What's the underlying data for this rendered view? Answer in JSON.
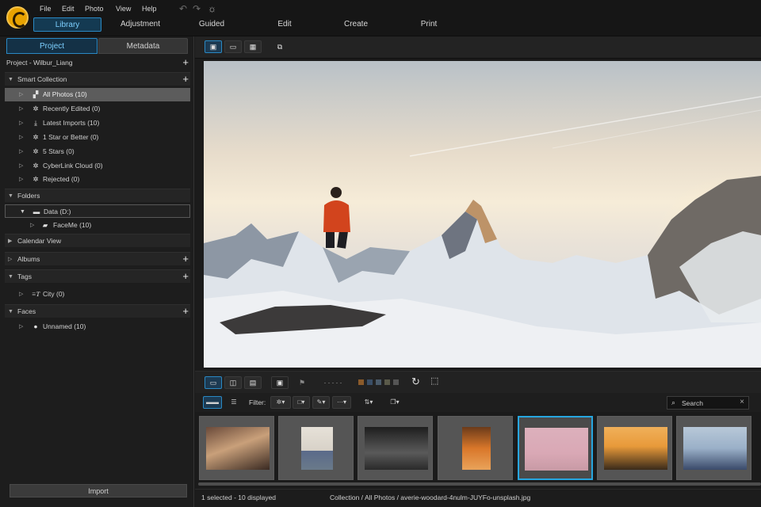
{
  "menu": [
    "File",
    "Edit",
    "Photo",
    "View",
    "Help"
  ],
  "modes": [
    "Library",
    "Adjustment",
    "Guided",
    "Edit",
    "Create",
    "Print"
  ],
  "panel_tabs": [
    "Project",
    "Metadata"
  ],
  "project": {
    "title": "Project - Wilbur_Liang"
  },
  "smart_collection": {
    "title": "Smart Collection",
    "items": [
      {
        "label": "All Photos (10)",
        "icon": "all-photos-icon"
      },
      {
        "label": "Recently Edited (0)",
        "icon": "smart-collection-icon"
      },
      {
        "label": "Latest Imports (10)",
        "icon": "latest-imports-icon"
      },
      {
        "label": "1 Star or Better (0)",
        "icon": "smart-collection-icon"
      },
      {
        "label": "5 Stars (0)",
        "icon": "smart-collection-icon"
      },
      {
        "label": "CyberLink Cloud (0)",
        "icon": "smart-collection-icon"
      },
      {
        "label": "Rejected (0)",
        "icon": "smart-collection-icon"
      }
    ]
  },
  "folders": {
    "title": "Folders",
    "drive": "Data (D:)",
    "subfolder": "FaceMe (10)"
  },
  "calendar": {
    "title": "Calendar View"
  },
  "albums": {
    "title": "Albums"
  },
  "tags": {
    "title": "Tags",
    "items": [
      "City (0)"
    ]
  },
  "faces": {
    "title": "Faces",
    "items": [
      "Unnamed (10)"
    ]
  },
  "import_label": "Import",
  "filter": {
    "label": "Filter:"
  },
  "search": {
    "placeholder": "Search"
  },
  "status": {
    "selection": "1 selected - 10 displayed",
    "path": "Collection / All Photos / averie-woodard-4nulm-JUYFo-unsplash.jpg"
  },
  "colors": {
    "accent": "#2a89c4",
    "selected_outline": "#27a6df",
    "logo": "#e8a200"
  },
  "thumbnails": [
    {
      "name": "crowd-selfie",
      "colors": [
        "#5a3a2a",
        "#c9a07a"
      ]
    },
    {
      "name": "group-on-beach",
      "colors": [
        "#d8d2c8",
        "#6a7a8a"
      ]
    },
    {
      "name": "band-outdoors",
      "colors": [
        "#2a2a2a",
        "#7a7a7a"
      ]
    },
    {
      "name": "woman-orange-praying",
      "colors": [
        "#d9772a",
        "#6b3b1a"
      ]
    },
    {
      "name": "woman-pink-wall",
      "colors": [
        "#d9a8b5",
        "#f0c8c8"
      ]
    },
    {
      "name": "woman-sunset-hat",
      "colors": [
        "#e89a3a",
        "#3a2a1a"
      ]
    },
    {
      "name": "friends-street",
      "colors": [
        "#9ab0c8",
        "#3a4a6a"
      ]
    }
  ]
}
